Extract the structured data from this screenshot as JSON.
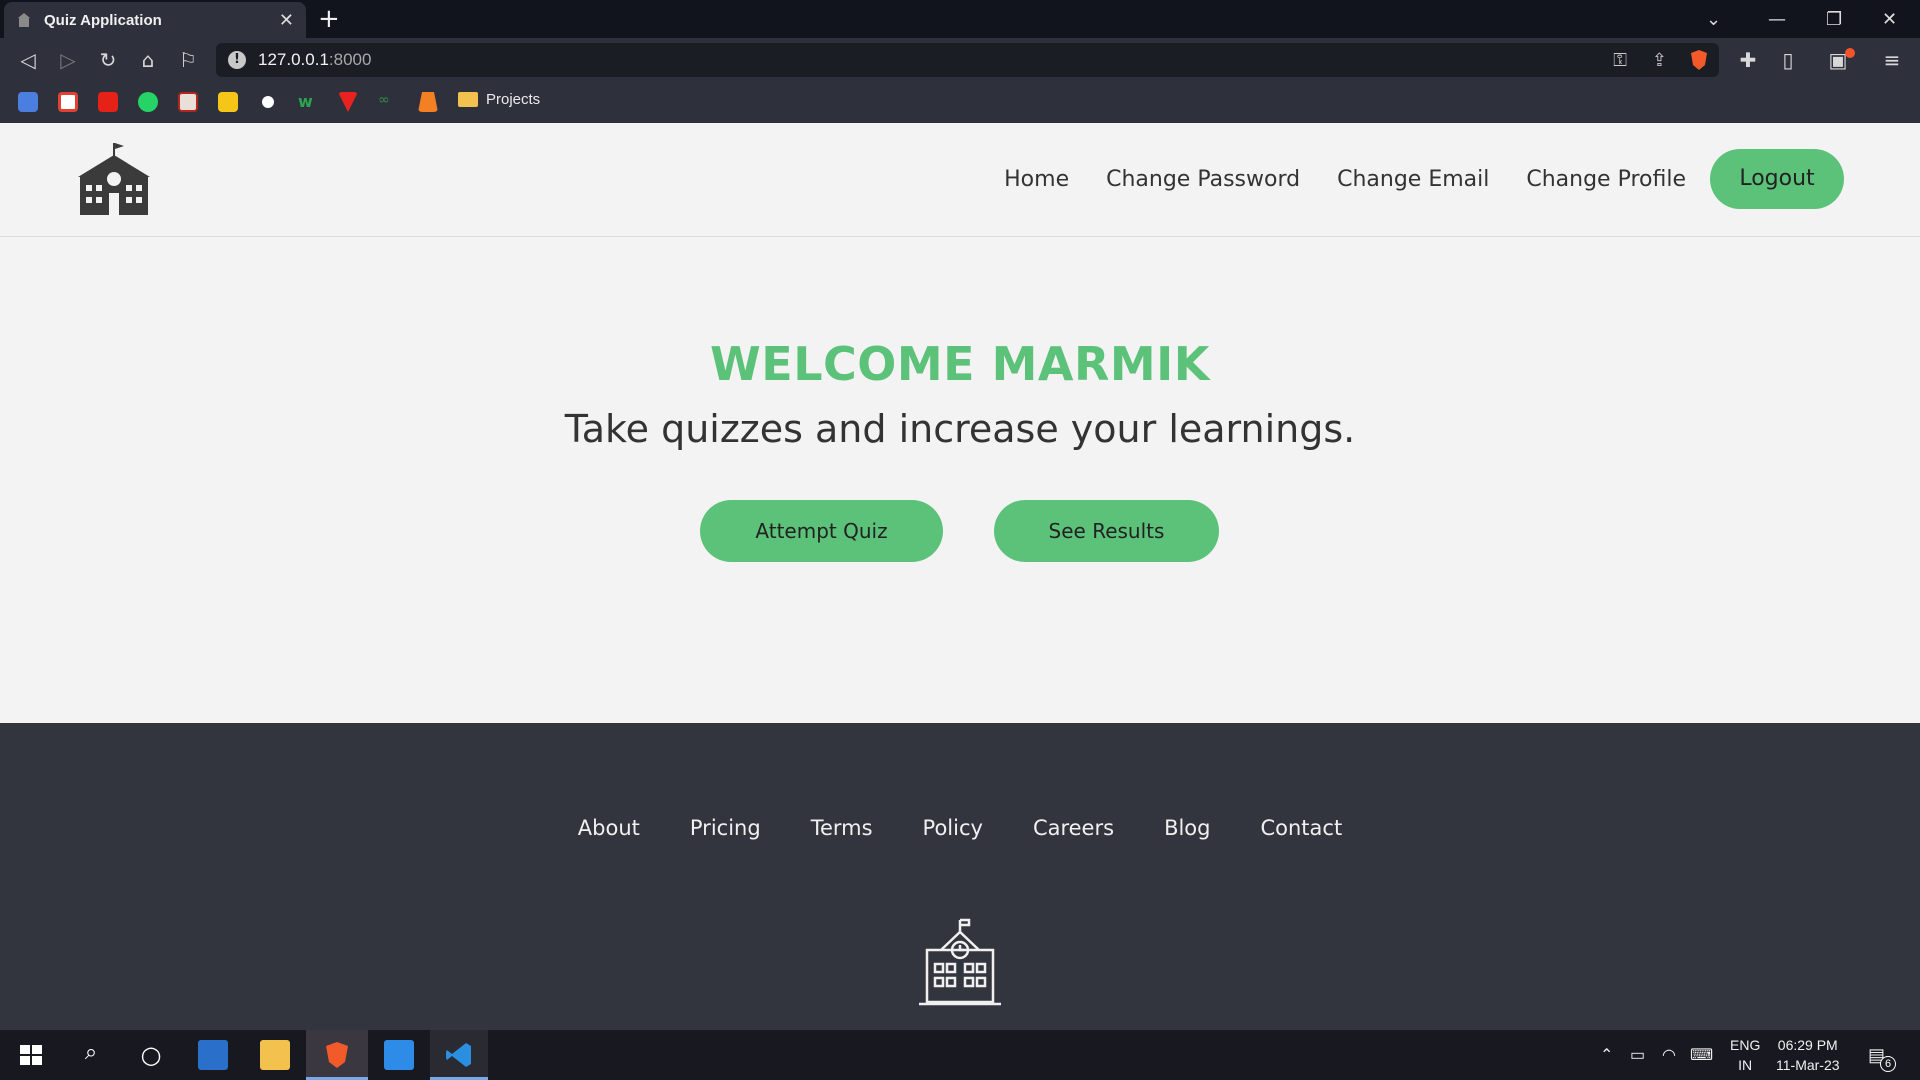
{
  "browser": {
    "tab_title": "Quiz Application",
    "new_tab": "+",
    "url_host": "127.0.0.1",
    "url_port": ":8000",
    "bookmarks_folder": "Projects"
  },
  "site": {
    "nav": {
      "home": "Home",
      "change_password": "Change Password",
      "change_email": "Change Email",
      "change_profile": "Change Profile",
      "logout": "Logout"
    },
    "hero": {
      "title": "WELCOME MARMIK",
      "subtitle": "Take quizzes and increase your learnings.",
      "attempt_button": "Attempt Quiz",
      "results_button": "See Results"
    },
    "footer": {
      "links": [
        "About",
        "Pricing",
        "Terms",
        "Policy",
        "Careers",
        "Blog",
        "Contact"
      ]
    },
    "colors": {
      "accent": "#5cc27a",
      "footer_bg": "#32353e"
    }
  },
  "taskbar": {
    "lang_top": "ENG",
    "lang_bottom": "IN",
    "time": "06:29 PM",
    "date": "11-Mar-23",
    "notification_count": "6"
  }
}
